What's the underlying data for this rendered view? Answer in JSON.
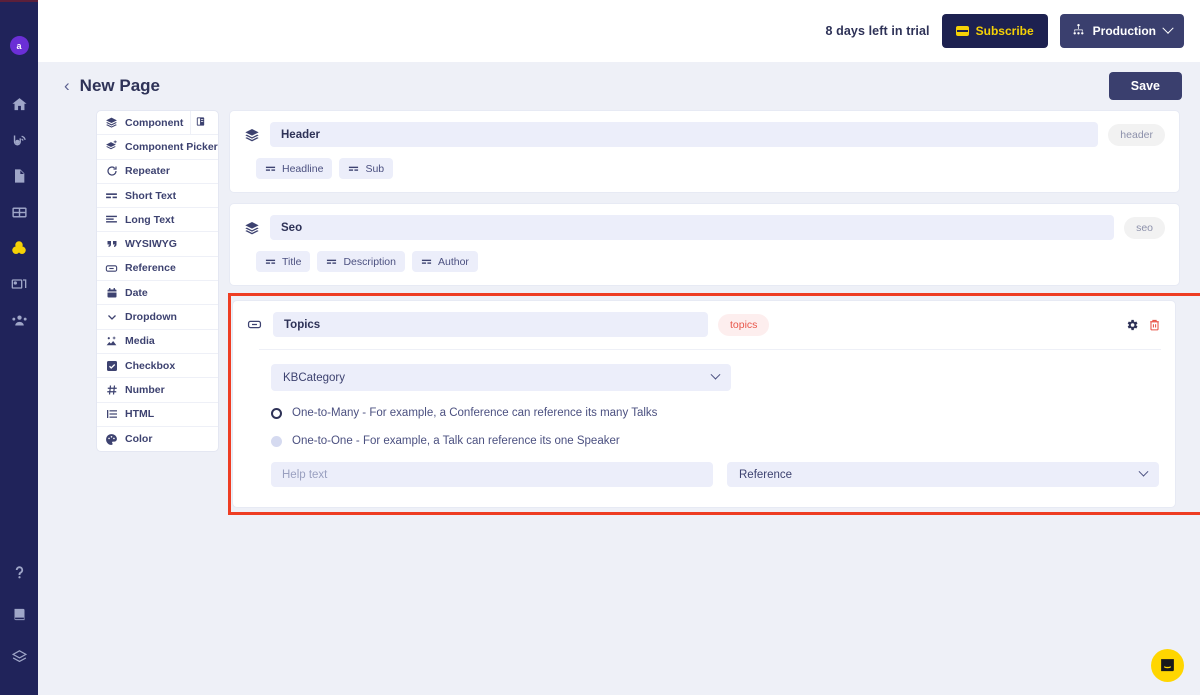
{
  "rail": {
    "avatar_letter": "a",
    "icons": [
      {
        "name": "home-icon"
      },
      {
        "name": "api-icon"
      },
      {
        "name": "document-icon"
      },
      {
        "name": "table-icon"
      },
      {
        "name": "components-icon",
        "active": true
      },
      {
        "name": "media-icon"
      },
      {
        "name": "team-icon"
      }
    ],
    "bottom_icons": [
      {
        "name": "help-icon"
      },
      {
        "name": "book-icon"
      },
      {
        "name": "layers-icon"
      }
    ]
  },
  "topbar": {
    "trial_text": "8 days left in trial",
    "subscribe_label": "Subscribe",
    "environment_label": "Production"
  },
  "pagehead": {
    "back_label": "‹",
    "title": "New Page",
    "save_label": "Save"
  },
  "type_panel": {
    "items": [
      {
        "label": "Component",
        "icon": "layers-icon"
      },
      {
        "label": "Component Picker",
        "icon": "layers-plus-icon"
      },
      {
        "label": "Repeater",
        "icon": "repeat-icon"
      },
      {
        "label": "Short Text",
        "icon": "short-text-icon"
      },
      {
        "label": "Long Text",
        "icon": "long-text-icon"
      },
      {
        "label": "WYSIWYG",
        "icon": "quote-icon"
      },
      {
        "label": "Reference",
        "icon": "link-icon"
      },
      {
        "label": "Date",
        "icon": "calendar-icon"
      },
      {
        "label": "Dropdown",
        "icon": "chevron-down-icon"
      },
      {
        "label": "Media",
        "icon": "image-icon"
      },
      {
        "label": "Checkbox",
        "icon": "checkbox-icon"
      },
      {
        "label": "Number",
        "icon": "hash-icon"
      },
      {
        "label": "HTML",
        "icon": "list-icon"
      },
      {
        "label": "Color",
        "icon": "palette-icon"
      }
    ]
  },
  "components": [
    {
      "name": "Header",
      "slug": "header",
      "fields": [
        {
          "label": "Headline",
          "icon": "short-text-icon"
        },
        {
          "label": "Sub",
          "icon": "short-text-icon"
        }
      ]
    },
    {
      "name": "Seo",
      "slug": "seo",
      "fields": [
        {
          "label": "Title",
          "icon": "short-text-icon"
        },
        {
          "label": "Description",
          "icon": "short-text-icon"
        },
        {
          "label": "Author",
          "icon": "short-text-icon"
        }
      ]
    }
  ],
  "selected_field": {
    "name": "Topics",
    "slug": "topics",
    "reference_model": "KBCategory",
    "relation_options": [
      {
        "label": "One-to-Many - For example, a Conference can reference its many Talks",
        "selected": true
      },
      {
        "label": "One-to-One - For example, a Talk can reference its one Speaker",
        "selected": false
      }
    ],
    "help_text_value": "",
    "help_text_placeholder": "Help text",
    "field_type_label": "Reference",
    "settings_icon": "gear-icon",
    "delete_icon": "trash-icon",
    "highlight_color": "#ee3d23"
  },
  "intercom": {
    "name": "intercom-launcher"
  }
}
